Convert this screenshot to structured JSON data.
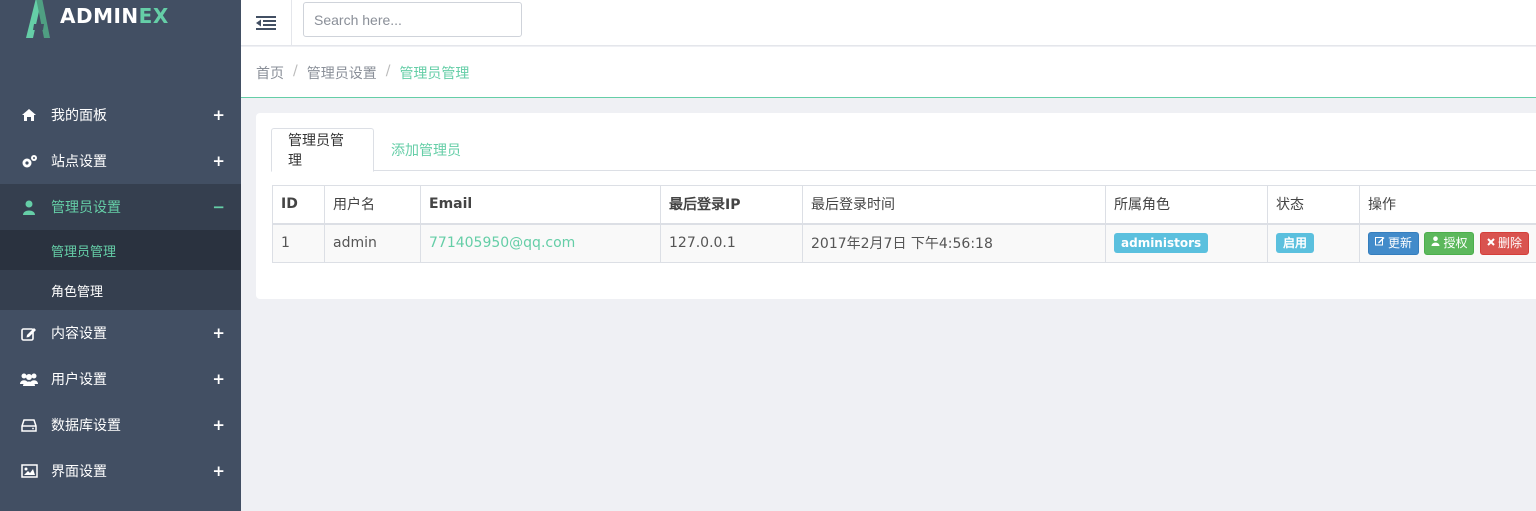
{
  "app": {
    "logo_prefix": "ADMIN",
    "logo_suffix": "EX",
    "brand_color": "#65cea7"
  },
  "sidebar": {
    "items": [
      {
        "label": "我的面板",
        "icon": "home-icon",
        "toggle": "+"
      },
      {
        "label": "站点设置",
        "icon": "cogs-icon",
        "toggle": "+"
      },
      {
        "label": "管理员设置",
        "icon": "user-icon",
        "toggle": "−",
        "active": true,
        "children": [
          {
            "label": "管理员管理",
            "current": true
          },
          {
            "label": "角色管理"
          }
        ]
      },
      {
        "label": "内容设置",
        "icon": "edit-icon",
        "toggle": "+"
      },
      {
        "label": "用户设置",
        "icon": "users-icon",
        "toggle": "+"
      },
      {
        "label": "数据库设置",
        "icon": "hdd-icon",
        "toggle": "+"
      },
      {
        "label": "界面设置",
        "icon": "picture-icon",
        "toggle": "+"
      }
    ]
  },
  "header": {
    "toggle_icon": "menu-toggle-icon",
    "search_placeholder": "Search here..."
  },
  "breadcrumb": {
    "items": [
      "首页",
      "管理员设置",
      "管理员管理"
    ],
    "separator": "/"
  },
  "tabs": [
    {
      "label": "管理员管理",
      "active": true
    },
    {
      "label": "添加管理员"
    }
  ],
  "table": {
    "headers": [
      "ID",
      "用户名",
      "Email",
      "最后登录IP",
      "最后登录时间",
      "所属角色",
      "状态",
      "操作"
    ],
    "rows": [
      {
        "id": "1",
        "username": "admin",
        "email": "771405950@qq.com",
        "last_ip": "127.0.0.1",
        "last_time": "2017年2月7日 下午4:56:18",
        "role": "administors",
        "status": "启用",
        "actions": {
          "update": "更新",
          "grant": "授权",
          "delete": "删除"
        }
      }
    ]
  }
}
